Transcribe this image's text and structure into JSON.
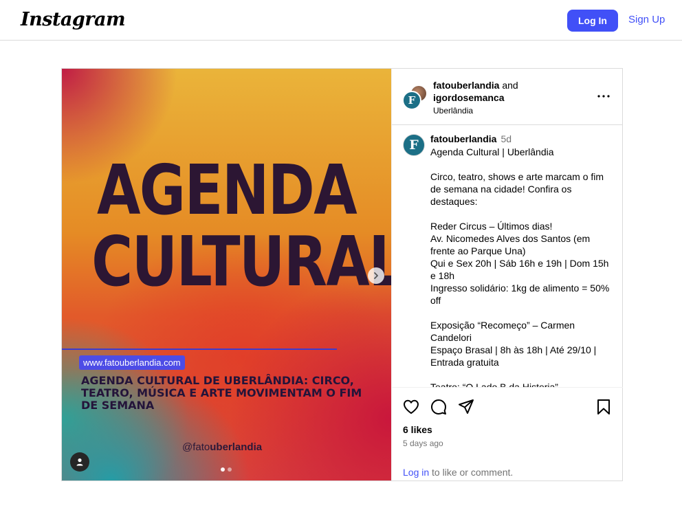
{
  "header": {
    "logo": "Instagram",
    "login_label": "Log In",
    "signup_label": "Sign Up"
  },
  "post": {
    "image": {
      "headline_line1": "AGENDA",
      "headline_line2": "CULTURAL",
      "url": "www.fatouberlandia.com",
      "subhead": "AGENDA CULTURAL DE UBERLÂNDIA: CIRCO, TEATRO, MÚSICA E ARTE MOVIMENTAM O FIM DE SEMANA",
      "handle_prefix": "@fato",
      "handle_suffix": "uberlandia",
      "carousel_count": 2,
      "carousel_active": 1
    },
    "head": {
      "author": "fatouberlandia",
      "joiner": "and",
      "coauthor": "igordosemanca",
      "location": "Uberlândia",
      "avatar_letter": "F"
    },
    "caption": {
      "username": "fatouberlandia",
      "time": "5d",
      "text": "Agenda Cultural | Uberlândia\n\nCirco, teatro, shows e arte marcam o fim de semana na cidade! Confira os destaques:\n\nReder Circus – Últimos dias!\nAv. Nicomedes Alves dos Santos (em frente ao Parque Una)\nQui e Sex 20h | Sáb 16h e 19h | Dom 15h e 18h\nIngresso solidário: 1kg de alimento = 50% off\n\nExposição “Recomeço” – Carmen Candelori\nEspaço Brasal | 8h às 18h | Até 29/10 | Entrada gratuita\n\nTeatro: “O Lado B da Histeria”"
    },
    "likes": "6 likes",
    "ago": "5 days ago",
    "login_prompt": {
      "link": "Log in",
      "rest": " to like or comment."
    }
  },
  "colors": {
    "accent": "#4150f7",
    "muted": "#737373",
    "border": "#dbdbdb"
  },
  "icons": [
    "heart-icon",
    "comment-icon",
    "share-icon",
    "bookmark-icon",
    "more-icon",
    "chevron-right-icon",
    "user-tag-icon"
  ]
}
